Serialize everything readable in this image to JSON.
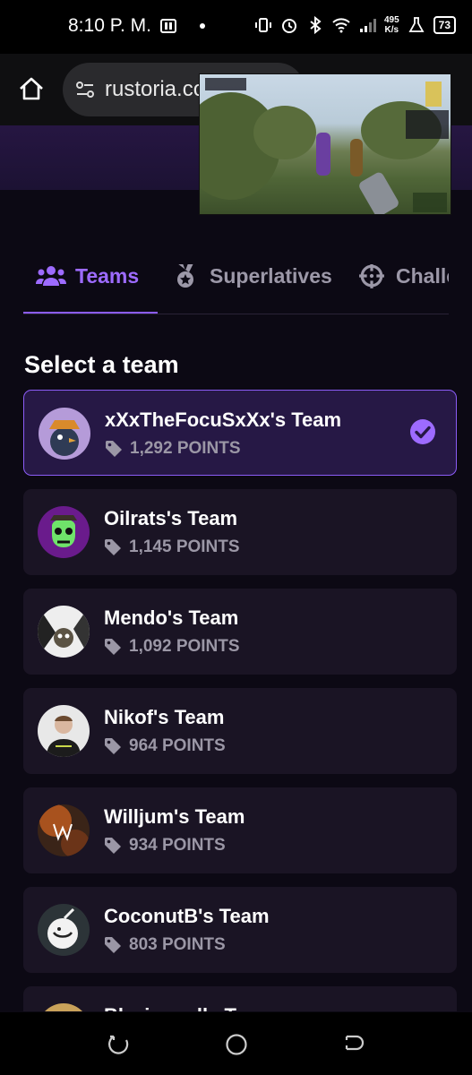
{
  "status_bar": {
    "time": "8:10 P. M.",
    "net_speed_value": "495",
    "net_speed_unit": "K/s",
    "battery": "73"
  },
  "browser": {
    "url": "rustoria.co"
  },
  "tabs": [
    {
      "label": "Teams",
      "icon": "users-icon",
      "active": true
    },
    {
      "label": "Superlatives",
      "icon": "medal-icon",
      "active": false
    },
    {
      "label": "Challenges",
      "icon": "crosshair-icon",
      "active": false
    }
  ],
  "section_title": "Select a team",
  "teams": [
    {
      "name": "xXxTheFocuSxXx's Team",
      "points": "1,292 POINTS",
      "selected": true
    },
    {
      "name": "Oilrats's Team",
      "points": "1,145 POINTS",
      "selected": false
    },
    {
      "name": "Mendo's Team",
      "points": "1,092 POINTS",
      "selected": false
    },
    {
      "name": "Nikof's Team",
      "points": "964 POINTS",
      "selected": false
    },
    {
      "name": "Willjum's Team",
      "points": "934 POINTS",
      "selected": false
    },
    {
      "name": "CoconutB's Team",
      "points": "803 POINTS",
      "selected": false
    },
    {
      "name": "Blazingpalls Team",
      "points": "",
      "selected": false
    }
  ],
  "colors": {
    "accent": "#8b5cf6",
    "background": "#0c0914",
    "card": "#1a1424",
    "card_selected": "#261845"
  }
}
